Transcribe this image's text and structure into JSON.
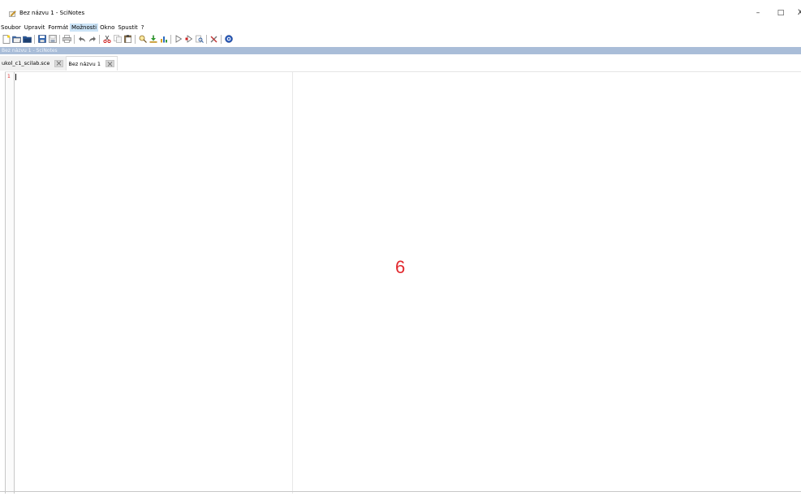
{
  "window": {
    "title": "Bez názvu 1 - SciNotes",
    "app_icon": "scinotes-pencil-icon",
    "minimize_glyph": "–",
    "maximize_glyph": "□",
    "close_glyph": "X"
  },
  "menu": {
    "items": [
      "Soubor",
      "Upravit",
      "Formát",
      "Možnosti",
      "Okno",
      "Spustit",
      "?"
    ],
    "active": "Možnosti"
  },
  "toolbar": {
    "icons": [
      "new-file-icon",
      "open-folder-icon",
      "open-recent-icon",
      "save-icon",
      "save-as-icon",
      "print-icon",
      "undo-icon",
      "redo-icon",
      "cut-icon",
      "copy-icon",
      "paste-icon",
      "find-icon",
      "load-into-scilab-icon",
      "execute-icon",
      "run-icon",
      "run-debug-icon",
      "search-icon",
      "tools-icon",
      "help-icon"
    ]
  },
  "document_bar": {
    "text": "Bez názvu 1 - SciNotes"
  },
  "tabs": [
    {
      "label": "ukol_c1_scilab.sce",
      "active": false
    },
    {
      "label": "Bez názvu 1",
      "active": true
    }
  ],
  "editor": {
    "line_numbers": [
      "1"
    ],
    "content": ""
  },
  "overlay": {
    "number": "6",
    "color": "#e2282e"
  },
  "colors": {
    "document_bar": "#a9bdd8",
    "active_menu": "#cce4f7",
    "line_number": "#e03030"
  }
}
